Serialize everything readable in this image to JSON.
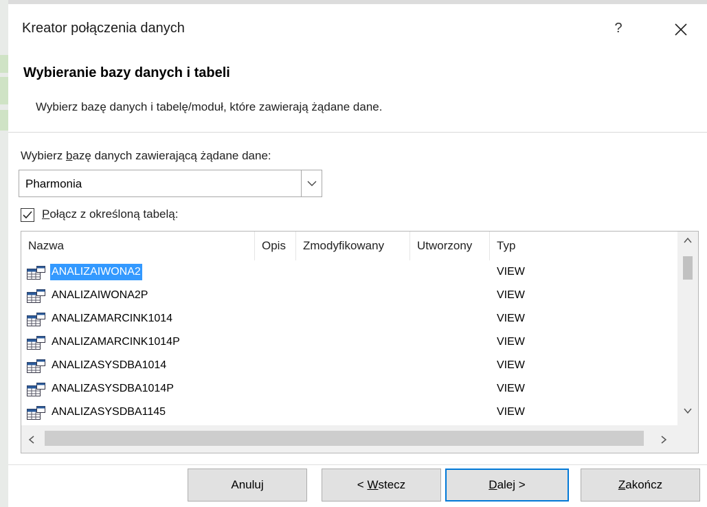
{
  "window": {
    "title": "Kreator połączenia danych",
    "help_label": "?",
    "close_label": "×"
  },
  "header": {
    "title": "Wybieranie bazy danych i tabeli",
    "description": "Wybierz bazę danych i tabelę/moduł, które zawierają żądane dane."
  },
  "database": {
    "label": "Wybierz bazę danych zawierającą żądane dane:",
    "selected": "Pharmonia"
  },
  "connect_to_table": {
    "label": "Połącz z określoną tabelą:",
    "checked": true
  },
  "table_list": {
    "columns": [
      "Nazwa",
      "Opis",
      "Zmodyfikowany",
      "Utworzony",
      "Typ"
    ],
    "rows": [
      {
        "name": "ANALIZAIWONA2",
        "type": "VIEW",
        "selected": true
      },
      {
        "name": "ANALIZAIWONA2P",
        "type": "VIEW"
      },
      {
        "name": "ANALIZAMARCINK1014",
        "type": "VIEW"
      },
      {
        "name": "ANALIZAMARCINK1014P",
        "type": "VIEW"
      },
      {
        "name": "ANALIZASYSDBA1014",
        "type": "VIEW"
      },
      {
        "name": "ANALIZASYSDBA1014P",
        "type": "VIEW"
      },
      {
        "name": "ANALIZASYSDBA1145",
        "type": "VIEW"
      }
    ]
  },
  "buttons": {
    "cancel": "Anuluj",
    "back": "< Wstecz",
    "next": "Dalej >",
    "finish": "Zakończ"
  },
  "icons": {
    "table_row": "table-view-icon",
    "dropdown": "chevron-down-icon",
    "scroll_up": "arrow-up-icon",
    "scroll_down": "arrow-down-icon",
    "scroll_left": "arrow-left-icon",
    "scroll_right": "arrow-right-icon"
  },
  "colors": {
    "selection": "#3399ff",
    "default_button_border": "#0078d7",
    "button_face": "#e1e1e1"
  }
}
